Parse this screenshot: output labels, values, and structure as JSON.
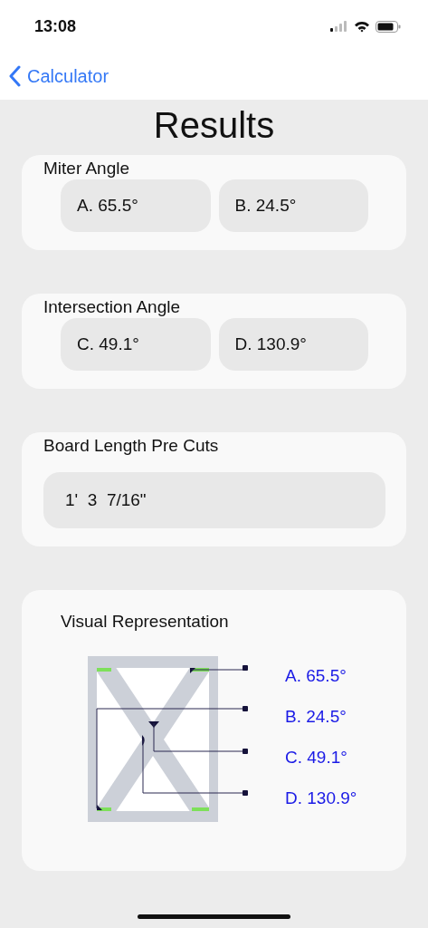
{
  "status_bar": {
    "time": "13:08"
  },
  "nav": {
    "back_label": "Calculator"
  },
  "title": "Results",
  "sections": [
    {
      "kind": "pair",
      "label": "Miter Angle",
      "values": [
        "A. 65.5°",
        "B. 24.5°"
      ]
    },
    {
      "kind": "pair",
      "label": "Intersection Angle",
      "values": [
        "C. 49.1°",
        "D. 130.9°"
      ]
    },
    {
      "kind": "single",
      "label": "Board Length Pre Cuts",
      "values": [
        "1'  3  7/16\""
      ]
    }
  ],
  "visual": {
    "label": "Visual Representation",
    "legend": [
      "A. 65.5°",
      "B. 24.5°",
      "C. 49.1°",
      "D. 130.9°"
    ]
  }
}
